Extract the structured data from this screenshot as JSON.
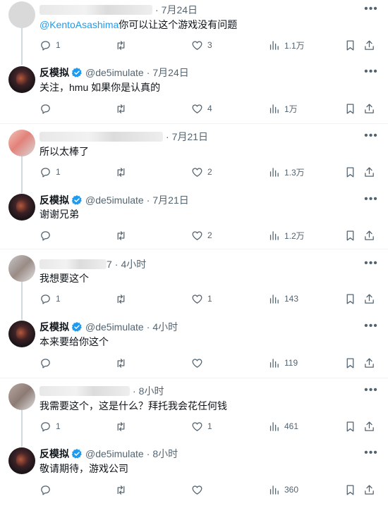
{
  "tweets": [
    {
      "name": "",
      "handle": "",
      "time": "7月24日",
      "mention": "@KentoAsashima",
      "text": "你可以让这个游戏没有问题",
      "replies": "1",
      "retweets": "",
      "likes": "3",
      "views": "1.1万"
    },
    {
      "name": "反模拟",
      "handle": "@de5imulate",
      "time": "7月24日",
      "text": "关注，hmu 如果你是认真的",
      "replies": "",
      "retweets": "",
      "likes": "4",
      "views": "1万"
    },
    {
      "name": "",
      "handle": "",
      "time": "7月21日",
      "text": "所以太棒了",
      "replies": "1",
      "retweets": "",
      "likes": "2",
      "views": "1.3万"
    },
    {
      "name": "反模拟",
      "handle": "@de5imulate",
      "time": "7月21日",
      "text": "谢谢兄弟",
      "replies": "",
      "retweets": "",
      "likes": "2",
      "views": "1.2万"
    },
    {
      "name": "",
      "handle": "7",
      "time": "4小时",
      "text": "我想要这个",
      "replies": "1",
      "retweets": "",
      "likes": "1",
      "views": "143"
    },
    {
      "name": "反模拟",
      "handle": "@de5imulate",
      "time": "4小时",
      "text": "本来要给你这个",
      "replies": "",
      "retweets": "",
      "likes": "",
      "views": "119"
    },
    {
      "name": "",
      "handle": "",
      "time": "8小时",
      "text": "我需要这个，这是什么？拜托我会花任何钱",
      "replies": "1",
      "retweets": "",
      "likes": "1",
      "views": "461"
    },
    {
      "name": "反模拟",
      "handle": "@de5imulate",
      "time": "8小时",
      "text": "敬请期待，游戏公司",
      "replies": "",
      "retweets": "",
      "likes": "",
      "views": "360"
    }
  ],
  "glyphs": {
    "dot": "·",
    "more": "•••"
  },
  "colors": {
    "accent": "#1d9bf0",
    "muted": "#536471",
    "text": "#0f1419",
    "thread_line": "#cfd9de"
  }
}
